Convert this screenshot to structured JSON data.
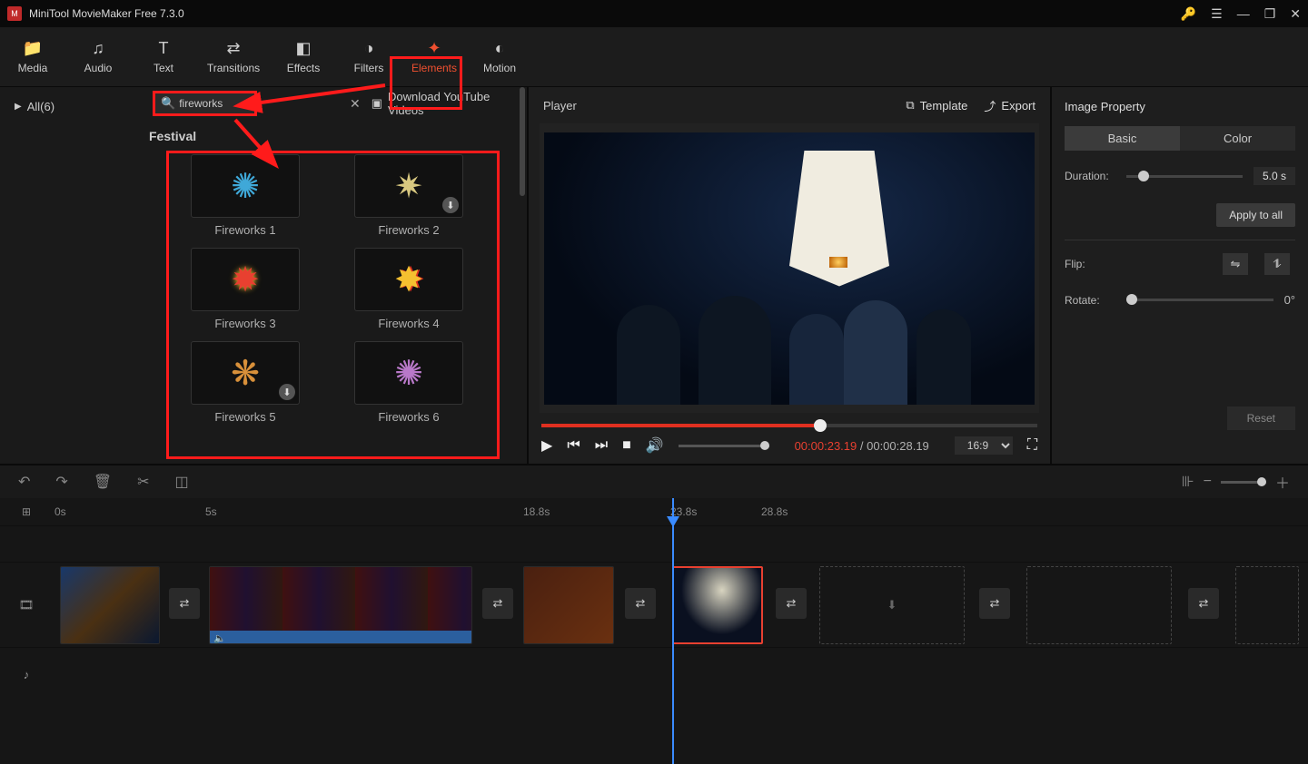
{
  "app": {
    "title": "MiniTool MovieMaker Free 7.3.0"
  },
  "toolbar": {
    "items": [
      {
        "key": "media",
        "label": "Media"
      },
      {
        "key": "audio",
        "label": "Audio"
      },
      {
        "key": "text",
        "label": "Text"
      },
      {
        "key": "transitions",
        "label": "Transitions"
      },
      {
        "key": "effects",
        "label": "Effects"
      },
      {
        "key": "filters",
        "label": "Filters"
      },
      {
        "key": "elements",
        "label": "Elements"
      },
      {
        "key": "motion",
        "label": "Motion"
      }
    ],
    "active": "elements"
  },
  "sidebar": {
    "category": "All(6)"
  },
  "search": {
    "value": "fireworks",
    "download_link": "Download YouTube Videos"
  },
  "elements": {
    "section": "Festival",
    "items": [
      {
        "label": "Fireworks 1",
        "has_dl": false
      },
      {
        "label": "Fireworks 2",
        "has_dl": true
      },
      {
        "label": "Fireworks 3",
        "has_dl": false
      },
      {
        "label": "Fireworks 4",
        "has_dl": false
      },
      {
        "label": "Fireworks 5",
        "has_dl": true
      },
      {
        "label": "Fireworks 6",
        "has_dl": false
      }
    ]
  },
  "player": {
    "title": "Player",
    "template": "Template",
    "export": "Export",
    "current": "00:00:23.19",
    "total": "00:00:28.19",
    "aspect": "16:9"
  },
  "props": {
    "title": "Image Property",
    "tab_basic": "Basic",
    "tab_color": "Color",
    "duration_label": "Duration:",
    "duration_value": "5.0 s",
    "apply": "Apply to all",
    "flip_label": "Flip:",
    "rotate_label": "Rotate:",
    "rotate_value": "0°",
    "reset": "Reset"
  },
  "ruler": {
    "marks": [
      {
        "pos": 60,
        "label": "0s"
      },
      {
        "pos": 226,
        "label": "5s"
      },
      {
        "pos": 576,
        "label": "18.8s"
      },
      {
        "pos": 738,
        "label": "23.8s"
      },
      {
        "pos": 838,
        "label": "28.8s"
      }
    ]
  }
}
